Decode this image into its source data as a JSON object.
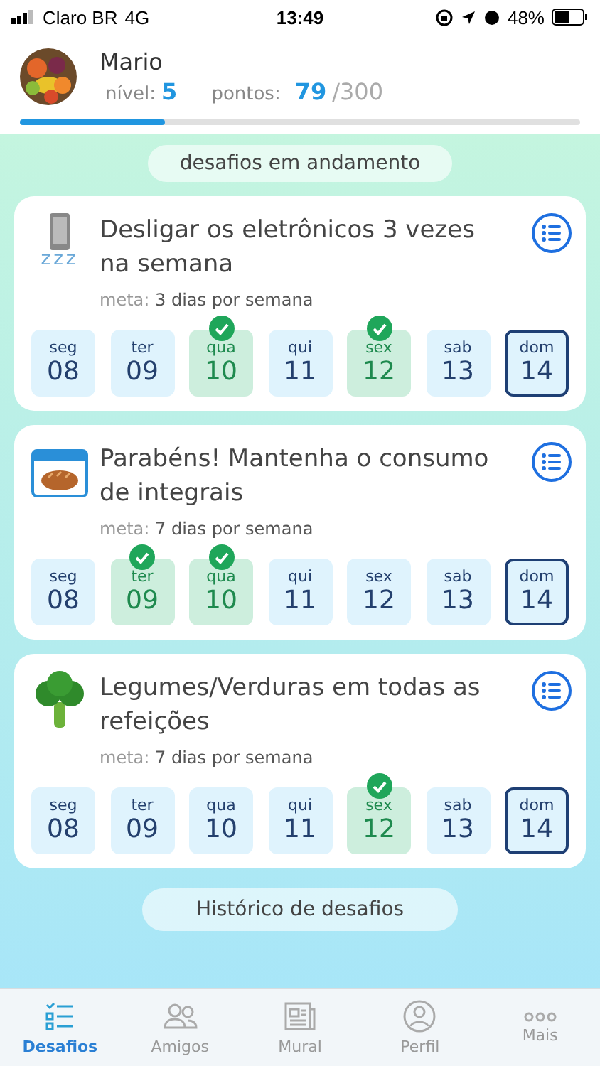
{
  "status_bar": {
    "carrier": "Claro BR",
    "network": "4G",
    "time": "13:49",
    "battery": "48%"
  },
  "profile": {
    "name": "Mario",
    "level_label": "nível:",
    "level_value": "5",
    "points_label": "pontos:",
    "points_value": "79",
    "points_total": "/300",
    "level": 0.26
  },
  "section_title": "desafios em andamento",
  "challenges": [
    {
      "icon_text": "zzz",
      "title": "Desligar os eletrônicos 3 vezes na semana",
      "goal_label": "meta:",
      "goal": "3 dias por semana",
      "days": [
        {
          "day": "seg",
          "date": "08",
          "done": false,
          "today": false
        },
        {
          "day": "ter",
          "date": "09",
          "done": false,
          "today": false
        },
        {
          "day": "qua",
          "date": "10",
          "done": true,
          "today": false
        },
        {
          "day": "qui",
          "date": "11",
          "done": false,
          "today": false
        },
        {
          "day": "sex",
          "date": "12",
          "done": true,
          "today": false
        },
        {
          "day": "sab",
          "date": "13",
          "done": false,
          "today": false
        },
        {
          "day": "dom",
          "date": "14",
          "done": false,
          "today": true
        }
      ]
    },
    {
      "title": "Parabéns! Mantenha o consumo de integrais",
      "goal_label": "meta:",
      "goal": "7 dias por semana",
      "days": [
        {
          "day": "seg",
          "date": "08",
          "done": false,
          "today": false
        },
        {
          "day": "ter",
          "date": "09",
          "done": true,
          "today": false
        },
        {
          "day": "qua",
          "date": "10",
          "done": true,
          "today": false
        },
        {
          "day": "qui",
          "date": "11",
          "done": false,
          "today": false
        },
        {
          "day": "sex",
          "date": "12",
          "done": false,
          "today": false
        },
        {
          "day": "sab",
          "date": "13",
          "done": false,
          "today": false
        },
        {
          "day": "dom",
          "date": "14",
          "done": false,
          "today": true
        }
      ]
    },
    {
      "title": "Legumes/Verduras em todas as refeições",
      "goal_label": "meta:",
      "goal": "7 dias por semana",
      "days": [
        {
          "day": "seg",
          "date": "08",
          "done": false,
          "today": false
        },
        {
          "day": "ter",
          "date": "09",
          "done": false,
          "today": false
        },
        {
          "day": "qua",
          "date": "10",
          "done": false,
          "today": false
        },
        {
          "day": "qui",
          "date": "11",
          "done": false,
          "today": false
        },
        {
          "day": "sex",
          "date": "12",
          "done": true,
          "today": false
        },
        {
          "day": "sab",
          "date": "13",
          "done": false,
          "today": false
        },
        {
          "day": "dom",
          "date": "14",
          "done": false,
          "today": true
        }
      ]
    }
  ],
  "history_button": "Histórico de desafios",
  "tabs": [
    {
      "label": "Desafios",
      "selected": true
    },
    {
      "label": "Amigos",
      "selected": false
    },
    {
      "label": "Mural",
      "selected": false
    },
    {
      "label": "Perfil",
      "selected": false
    },
    {
      "label": "Mais",
      "selected": false
    }
  ]
}
